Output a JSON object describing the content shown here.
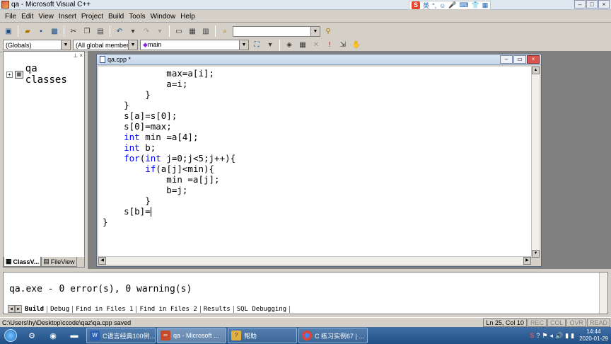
{
  "window": {
    "title": "qa - Microsoft Visual C++"
  },
  "ime": {
    "lang": "英",
    "items": [
      "°,",
      "☺",
      "🎤",
      "⌨",
      "👕",
      "▦"
    ]
  },
  "menu": {
    "items": [
      "File",
      "Edit",
      "View",
      "Insert",
      "Project",
      "Build",
      "Tools",
      "Window",
      "Help"
    ]
  },
  "wizardbar": {
    "scope": "(Globals)",
    "filter": "(All global members",
    "function": "main"
  },
  "workspace": {
    "root_label": "qa classes",
    "tabs": [
      "ClassV...",
      "FileView"
    ]
  },
  "editor": {
    "file_title": "qa.cpp *",
    "lines": [
      [
        [
          "",
          "            max=a[i];"
        ]
      ],
      [
        [
          "",
          "            a=i;"
        ]
      ],
      [
        [
          "",
          "        }"
        ]
      ],
      [
        [
          "",
          "    }"
        ]
      ],
      [
        [
          "",
          "    s[a]=s[0];"
        ]
      ],
      [
        [
          "",
          "    s[0]=max;"
        ]
      ],
      [
        [
          "kw",
          "    int"
        ],
        [
          "",
          " min =a[4];"
        ]
      ],
      [
        [
          "kw",
          "    int"
        ],
        [
          "",
          " b;"
        ]
      ],
      [
        [
          "kw",
          "    for"
        ],
        [
          "",
          "("
        ],
        [
          "kw",
          "int"
        ],
        [
          "",
          " j=0;j<5;j++){"
        ]
      ],
      [
        [
          "kw",
          "        if"
        ],
        [
          "",
          "(a[j]<min){"
        ]
      ],
      [
        [
          "",
          "            min =a[j];"
        ]
      ],
      [
        [
          "",
          "            b=j;"
        ]
      ],
      [
        [
          "",
          "        }"
        ]
      ],
      [
        [
          "",
          "    s[b]="
        ]
      ],
      [
        [
          "",
          "}"
        ]
      ]
    ]
  },
  "output": {
    "text": "qa.exe - 0 error(s), 0 warning(s)",
    "tabs": [
      "Build",
      "Debug",
      "Find in Files 1",
      "Find in Files 2",
      "Results",
      "SQL Debugging"
    ]
  },
  "status": {
    "message": "C:\\Users\\hy\\Desktop\\ccode\\qaz\\qa.cpp saved",
    "position": "Ln 25, Col 10",
    "flags": [
      "REC",
      "COL",
      "OVR",
      "READ"
    ]
  },
  "taskbar": {
    "buttons": [
      "C语言经典100例...",
      "qa - Microsoft ...",
      "帮助",
      "C 练习实例67 | ..."
    ],
    "time": "14:44",
    "date": "2020-01-29"
  }
}
